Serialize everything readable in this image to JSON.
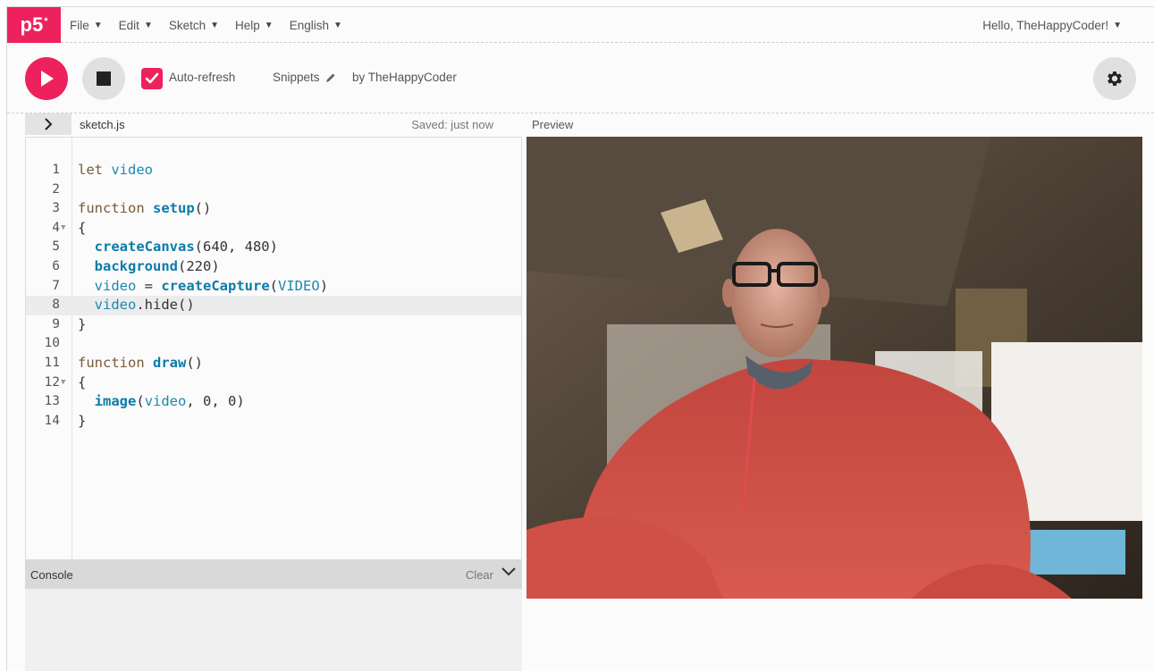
{
  "nav": {
    "logo_main": "p5",
    "logo_sup": "*",
    "menu": [
      {
        "label": "File"
      },
      {
        "label": "Edit"
      },
      {
        "label": "Sketch"
      },
      {
        "label": "Help"
      },
      {
        "label": "English"
      }
    ],
    "greeting": "Hello, TheHappyCoder!"
  },
  "toolbar": {
    "auto_refresh_label": "Auto-refresh",
    "auto_refresh_checked": true,
    "sketch_name": "Snippets",
    "byline": "by TheHappyCoder"
  },
  "editor": {
    "filename": "sketch.js",
    "saved_status": "Saved: just now",
    "active_line": 8,
    "lines": [
      {
        "n": "1",
        "text": "let video"
      },
      {
        "n": "2",
        "text": ""
      },
      {
        "n": "3",
        "text": "function setup()"
      },
      {
        "n": "4",
        "text": "{"
      },
      {
        "n": "5",
        "text": "  createCanvas(640, 480)"
      },
      {
        "n": "6",
        "text": "  background(220)"
      },
      {
        "n": "7",
        "text": "  video = createCapture(VIDEO)"
      },
      {
        "n": "8",
        "text": "  video.hide()"
      },
      {
        "n": "9",
        "text": "}"
      },
      {
        "n": "10",
        "text": ""
      },
      {
        "n": "11",
        "text": "function draw()"
      },
      {
        "n": "12",
        "text": "{"
      },
      {
        "n": "13",
        "text": "  image(video, 0, 0)"
      },
      {
        "n": "14",
        "text": "}"
      }
    ]
  },
  "console": {
    "title": "Console",
    "clear_label": "Clear"
  },
  "preview": {
    "label": "Preview"
  },
  "colors": {
    "accent": "#ed225d",
    "button_grey": "#e0e0e0",
    "keyword": "#7a5a3a",
    "function": "#0b7ca9"
  },
  "icons": {
    "play": "play-icon",
    "stop": "stop-icon",
    "check": "check-icon",
    "pencil": "pencil-icon",
    "gear": "gear-icon",
    "expand": "chevron-right-icon",
    "collapse": "chevron-down-icon"
  }
}
